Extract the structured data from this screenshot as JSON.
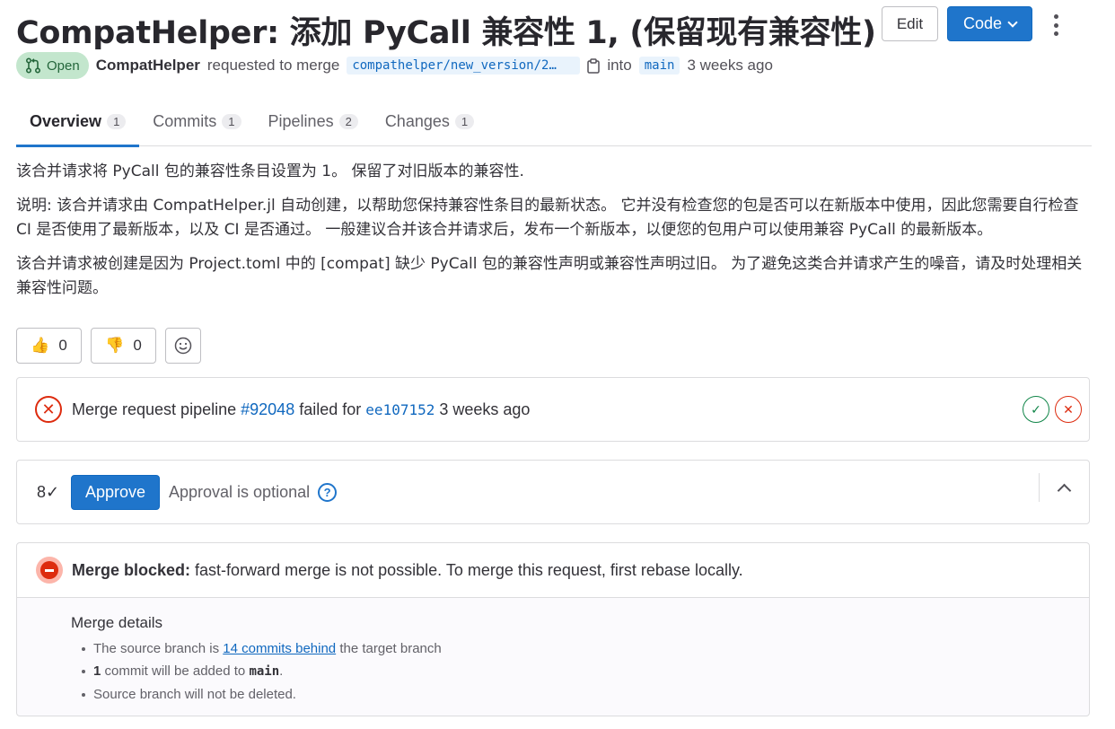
{
  "header": {
    "title": "CompatHelper: 添加 PyCall 兼容性 1, (保留现有兼容性)",
    "edit_label": "Edit",
    "code_label": "Code"
  },
  "meta": {
    "status": "Open",
    "author": "CompatHelper",
    "requested_text": "requested to merge",
    "source_branch": "compathelper/new_version/2…",
    "into_text": "into",
    "target_branch": "main",
    "time": "3 weeks ago"
  },
  "tabs": [
    {
      "label": "Overview",
      "count": "1"
    },
    {
      "label": "Commits",
      "count": "1"
    },
    {
      "label": "Pipelines",
      "count": "2"
    },
    {
      "label": "Changes",
      "count": "1"
    }
  ],
  "description": {
    "p1": "该合并请求将 PyCall 包的兼容性条目设置为 1。 保留了对旧版本的兼容性.",
    "p2": "说明: 该合并请求由 CompatHelper.jl 自动创建，以帮助您保持兼容性条目的最新状态。 它并没有检查您的包是否可以在新版本中使用，因此您需要自行检查 CI 是否使用了最新版本，以及 CI 是否通过。 一般建议合并该合并请求后，发布一个新版本，以便您的包用户可以使用兼容 PyCall 的最新版本。",
    "p3": "该合并请求被创建是因为 Project.toml 中的 [compat] 缺少 PyCall 包的兼容性声明或兼容性声明过旧。 为了避免这类合并请求产生的噪音，请及时处理相关兼容性问题。"
  },
  "reactions": {
    "thumbs_up": "0",
    "thumbs_down": "0"
  },
  "pipeline": {
    "prefix": "Merge request pipeline",
    "id": "#92048",
    "status_text": "failed for",
    "commit": "ee107152",
    "time": "3 weeks ago"
  },
  "approval": {
    "button": "Approve",
    "optional_text": "Approval is optional"
  },
  "merge": {
    "blocked_label": "Merge blocked:",
    "blocked_text": "fast-forward merge is not possible. To merge this request, first rebase locally.",
    "details_title": "Merge details",
    "d1_pre": "The source branch is",
    "d1_link": "14 commits behind",
    "d1_post": "the target branch",
    "d2_count": "1",
    "d2_mid": "commit will be added to",
    "d2_branch": "main",
    "d2_end": ".",
    "d3": "Source branch will not be deleted."
  },
  "colors": {
    "accent": "#1f75cb",
    "success": "#108548",
    "danger": "#dd2b0e",
    "open_badge_bg": "#c3e6cd"
  }
}
